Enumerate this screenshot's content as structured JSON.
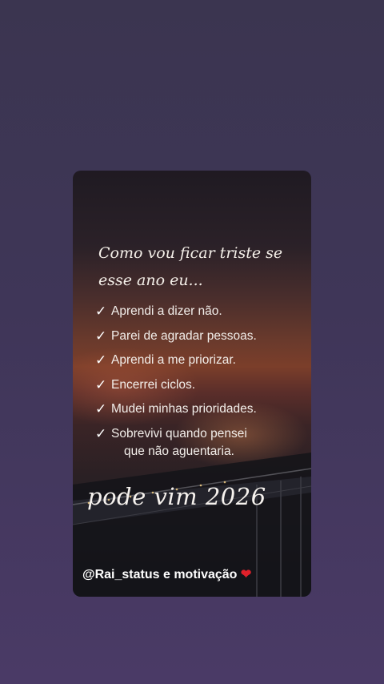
{
  "post": {
    "title_line1": "Como vou ficar triste se",
    "title_line2": "esse ano eu...",
    "items": [
      {
        "icon": "check-icon",
        "label": "Aprendi a dizer não."
      },
      {
        "icon": "check-icon",
        "label": "Parei de agradar pessoas."
      },
      {
        "icon": "check-icon",
        "label": "Aprendi a me priorizar."
      },
      {
        "icon": "check-icon",
        "label": "Encerrei ciclos."
      },
      {
        "icon": "check-icon",
        "label": "Mudei minhas prioridades."
      },
      {
        "icon": "check-icon",
        "label": "Sobrevivi quando pensei"
      }
    ],
    "item_continuation": "que não aguentaria.",
    "signature": "pode vim 2026",
    "handle": "@Rai_status e motivação",
    "handle_icon": "heart-icon"
  },
  "colors": {
    "page_background": "#3f3658",
    "text": "#f4efe8",
    "heart": "#e0202a"
  }
}
